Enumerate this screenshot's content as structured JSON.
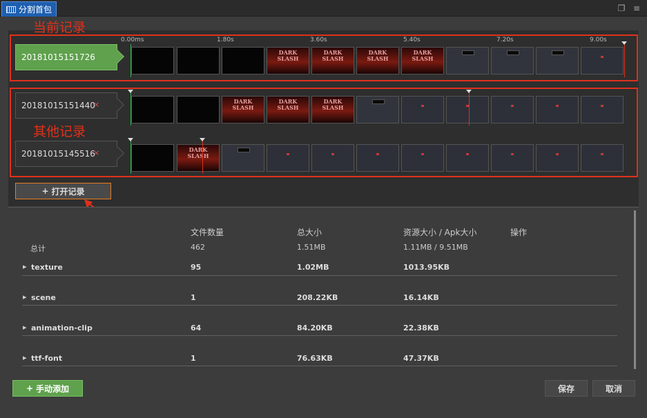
{
  "title": "分割首包",
  "annotations": {
    "current": "当前记录",
    "other": "其他记录"
  },
  "ruler_ticks": [
    "0.00ms",
    "1.80s",
    "3.60s",
    "5.40s",
    "7.20s",
    "9.00s"
  ],
  "current_record": {
    "id": "20181015151726"
  },
  "other_records": [
    {
      "id": "20181015151440",
      "delete_icon": "×"
    },
    {
      "id": "20181015145516",
      "delete_icon": "×"
    }
  ],
  "open_button": {
    "icon": "+",
    "label": "打开记录"
  },
  "table": {
    "headers": [
      "文件数量",
      "总大小",
      "资源大小 / Apk大小",
      "操作"
    ],
    "summary": {
      "label": "总计",
      "files": "462",
      "total": "1.51MB",
      "asset": "1.11MB / 9.51MB"
    },
    "rows": [
      {
        "name": "texture",
        "files": "95",
        "total": "1.02MB",
        "asset": "1013.95KB"
      },
      {
        "name": "scene",
        "files": "1",
        "total": "208.22KB",
        "asset": "16.14KB"
      },
      {
        "name": "animation-clip",
        "files": "64",
        "total": "84.20KB",
        "asset": "22.38KB"
      },
      {
        "name": "ttf-font",
        "files": "1",
        "total": "76.63KB",
        "asset": "47.37KB"
      }
    ]
  },
  "buttons": {
    "add": "手动添加",
    "add_icon": "+",
    "save": "保存",
    "cancel": "取消"
  },
  "colors": {
    "accent_green": "#5fa14d",
    "annotation_red": "#e0311b",
    "tab_blue": "#1e5fb0"
  }
}
